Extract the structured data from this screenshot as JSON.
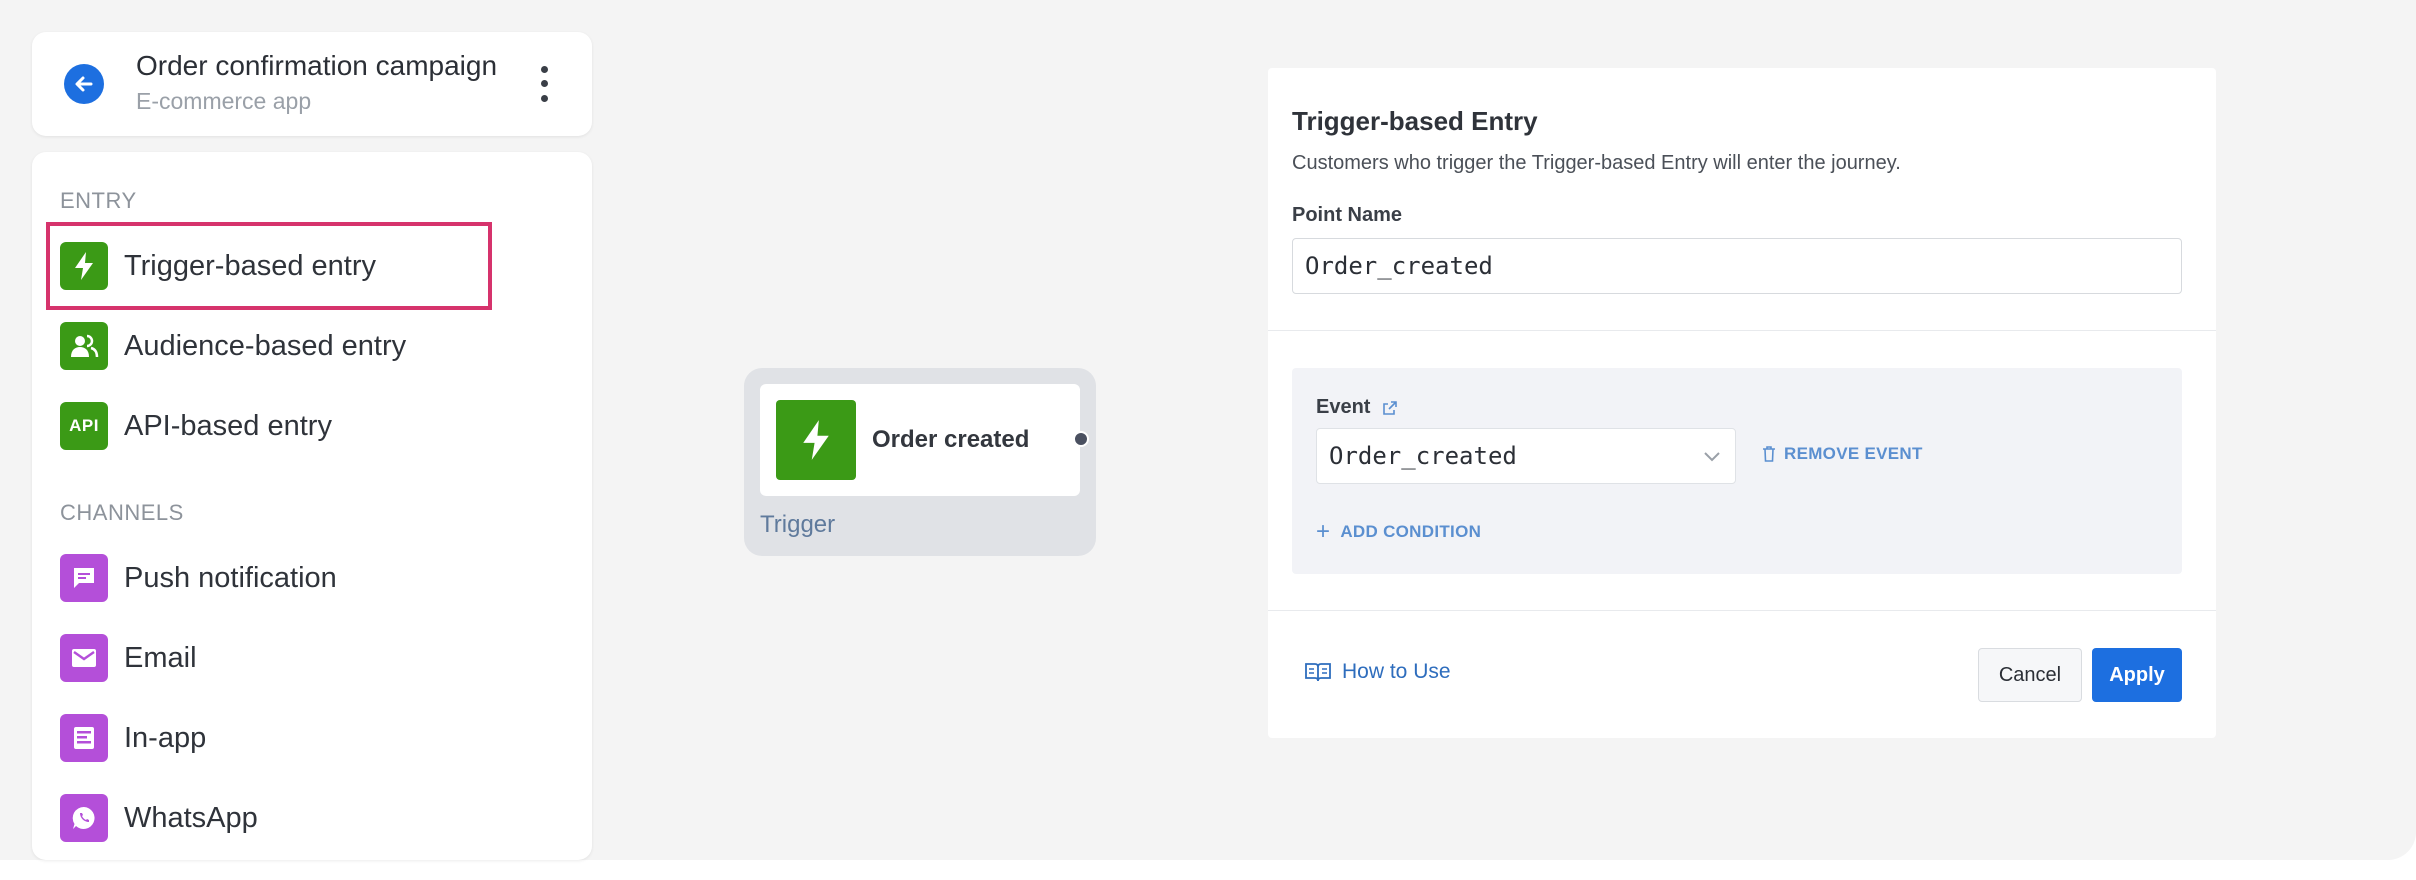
{
  "campaign": {
    "title": "Order confirmation campaign",
    "subtitle": "E-commerce app"
  },
  "palette": {
    "entry_heading": "ENTRY",
    "entry_items": [
      {
        "label": "Trigger-based entry",
        "icon": "lightning-icon",
        "selected": true
      },
      {
        "label": "Audience-based entry",
        "icon": "people-icon"
      },
      {
        "label": "API-based entry",
        "icon": "api-icon",
        "icon_text": "API"
      }
    ],
    "channels_heading": "CHANNELS",
    "channel_items": [
      {
        "label": "Push notification",
        "icon": "message-icon"
      },
      {
        "label": "Email",
        "icon": "envelope-icon"
      },
      {
        "label": "In-app",
        "icon": "in-app-icon"
      },
      {
        "label": "WhatsApp",
        "icon": "whatsapp-icon"
      }
    ]
  },
  "node": {
    "title": "Order created",
    "footer": "Trigger",
    "icon": "lightning-icon"
  },
  "panel": {
    "title": "Trigger-based Entry",
    "description": "Customers who trigger the Trigger-based Entry will enter the journey.",
    "point_name_label": "Point Name",
    "point_name_value": "Order_created",
    "event_label": "Event",
    "event_value": "Order_created",
    "remove_event": "REMOVE EVENT",
    "add_condition": "ADD CONDITION",
    "how_to_use": "How to Use",
    "cancel": "Cancel",
    "apply": "Apply"
  },
  "colors": {
    "accent": "#1d6fe0",
    "entry_tile": "#3b9a16",
    "channel_tile": "#b44fd9",
    "selection_outline": "#d6336c"
  }
}
